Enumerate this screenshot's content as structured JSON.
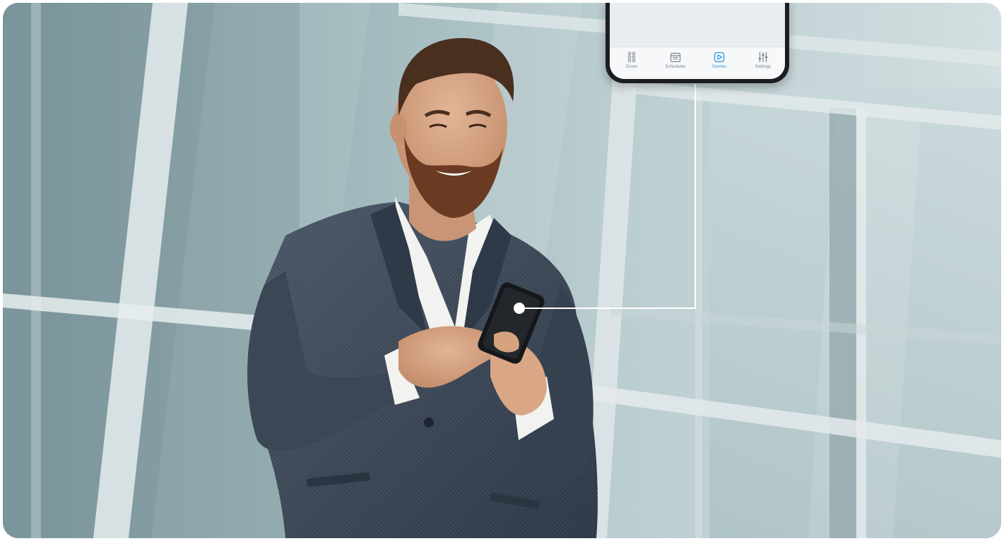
{
  "scene": {
    "subject": "bearded man in grey tweed blazer and white shirt looking at smartphone",
    "background": "glass facade with steel frame"
  },
  "colors": {
    "accent": "#2b9be0",
    "tab_inactive": "#7a8088",
    "callout_line": "#ffffff",
    "phone_body": "#1b1d21"
  },
  "app": {
    "tabs": [
      {
        "label": "Zones",
        "icon": "grid-icon",
        "active": false
      },
      {
        "label": "Schedules",
        "icon": "calendar-icon",
        "active": false
      },
      {
        "label": "Scenes",
        "icon": "play-icon",
        "active": true
      },
      {
        "label": "Settings",
        "icon": "sliders-icon",
        "active": false
      }
    ]
  }
}
